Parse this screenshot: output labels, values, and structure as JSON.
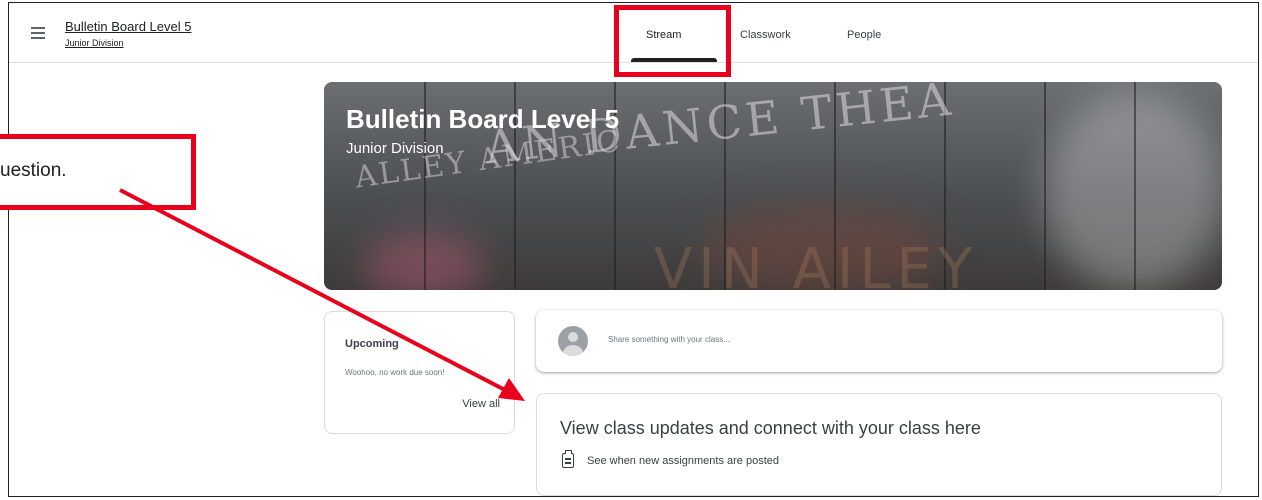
{
  "header": {
    "class_name": "Bulletin Board Level 5",
    "section": "Junior Division",
    "tabs": [
      {
        "label": "Stream",
        "active": true
      },
      {
        "label": "Classwork",
        "active": false
      },
      {
        "label": "People",
        "active": false
      }
    ]
  },
  "banner": {
    "title": "Bulletin Board Level 5",
    "subtitle": "Junior Division"
  },
  "upcoming": {
    "title": "Upcoming",
    "empty_text": "Woohoo, no work due soon!",
    "view_all": "View all"
  },
  "share": {
    "placeholder": "Share something with your class..."
  },
  "updates": {
    "title": "View class updates and connect with your class here",
    "note": "See when new assignments are posted"
  },
  "annotation": {
    "text": "uestion.",
    "color": "#e8001c"
  },
  "colors": {
    "highlight": "#e8001c",
    "text": "#3c4043",
    "border": "#dadce0"
  }
}
